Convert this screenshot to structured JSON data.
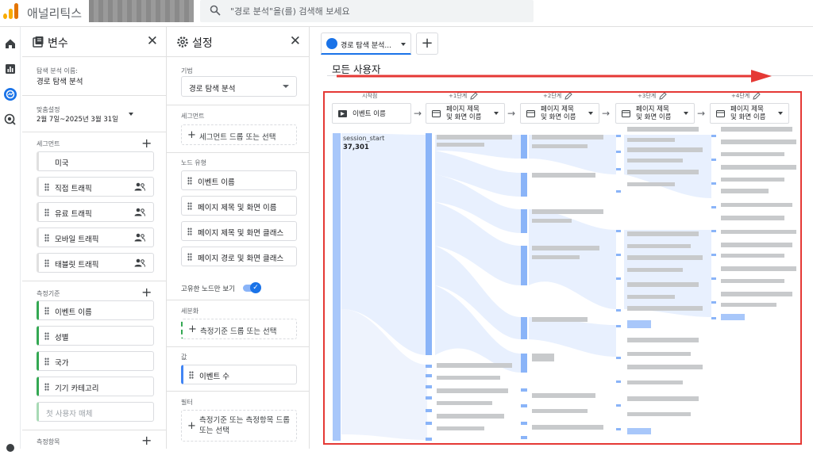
{
  "app": {
    "title": "애널리틱스"
  },
  "search": {
    "placeholder": "\"경로 분석\"을(를) 검색해 보세요"
  },
  "variables_panel": {
    "title": "변수",
    "exploration_name_label": "탐색 분석 이름:",
    "exploration_name": "경로 탐색 분석",
    "date_label": "맞춤설정",
    "date_range": "2월 7일~2025년 3월 31일",
    "segments_label": "세그먼트",
    "segments": [
      "미국",
      "직접 트래픽",
      "유료 트래픽",
      "모바일 트래픽",
      "태블릿 트래픽"
    ],
    "dimensions_label": "측정기준",
    "dimensions": [
      "이벤트 이름",
      "성별",
      "국가",
      "기기 카테고리"
    ],
    "dimensions_ghost": "첫 사용자 매체",
    "metrics_label": "측정항목"
  },
  "settings_panel": {
    "title": "설정",
    "technique_label": "기법",
    "technique_value": "경로 탐색 분석",
    "segment_label": "세그먼트",
    "segment_drop": "세그먼트 드롭 또는 선택",
    "node_type_label": "노드 유형",
    "node_types": [
      "이벤트 이름",
      "페이지 제목 및 화면 이름",
      "페이지 제목 및 화면 클래스",
      "페이지 경로 및 화면 클래스"
    ],
    "unique_nodes_label": "고유한 노드만 보기",
    "breakdown_label": "세분화",
    "breakdown_drop": "측정기준 드롭 또는 선택",
    "values_label": "값",
    "values_item": "이벤트 수",
    "filters_label": "필터",
    "filters_drop": "측정기준 또는 측정항목 드롭 또는 선택"
  },
  "tabs": {
    "active_label": "경로 탐색 분석..."
  },
  "canvas": {
    "segment_title": "모든 사용자",
    "steps": [
      "시작점",
      "+1단계",
      "+2단계",
      "+3단계",
      "+4단계"
    ],
    "node_headers": [
      "이벤트 이름",
      "페이지 제목|및 화면 이름",
      "페이지 제목|및 화면 이름",
      "페이지 제목|및 화면 이름",
      "페이지 제목|및 화면 이름"
    ],
    "start_node": {
      "label": "session_start",
      "value": "37,301"
    }
  },
  "colors": {
    "accent": "#1a73e8",
    "node": "#8ab4f8",
    "flow": "#e8f0fe",
    "highlight": "#e53935"
  }
}
